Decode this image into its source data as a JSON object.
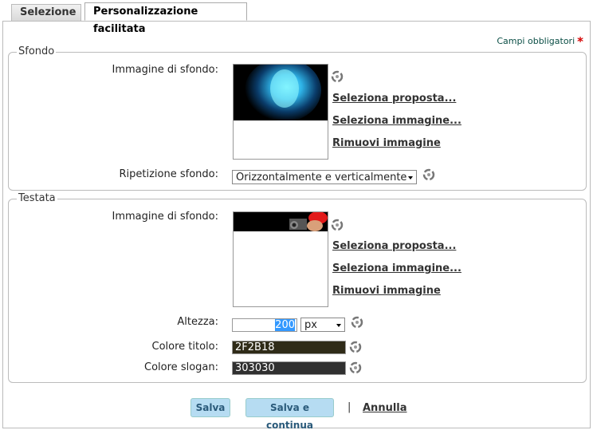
{
  "tabs": {
    "selezione": "Selezione",
    "personalizzazione": "Personalizzazione facilitata"
  },
  "required_note": "Campi obbligatori",
  "sfondo": {
    "legend": "Sfondo",
    "image_label": "Immagine di sfondo:",
    "select_proposal": "Seleziona proposta...",
    "select_image": "Seleziona immagine...",
    "remove_image": "Rimuovi immagine",
    "repeat_label": "Ripetizione sfondo:",
    "repeat_value": "Orizzontalmente e verticalmente"
  },
  "testata": {
    "legend": "Testata",
    "image_label": "Immagine di sfondo:",
    "select_proposal": "Seleziona proposta...",
    "select_image": "Seleziona immagine...",
    "remove_image": "Rimuovi immagine",
    "height_label": "Altezza:",
    "height_value": "200",
    "height_unit": "px",
    "title_color_label": "Colore titolo:",
    "title_color_value": "2F2B18",
    "title_color": "#2F2B18",
    "slogan_color_label": "Colore slogan:",
    "slogan_color_value": "303030",
    "slogan_color": "#303030"
  },
  "actions": {
    "save": "Salva",
    "save_continue": "Salva e continua",
    "separator": "|",
    "cancel": "Annulla"
  },
  "icons": {
    "reset": "reset-icon",
    "required": "asterisk-icon",
    "dropdown": "chevron-down-icon"
  }
}
